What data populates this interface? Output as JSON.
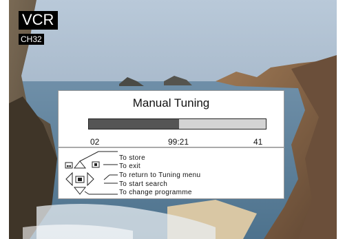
{
  "overlay": {
    "source_label": "VCR",
    "channel_label": "CH32"
  },
  "panel": {
    "title": "Manual Tuning",
    "progress_fraction": 0.51,
    "left_value": "02",
    "center_value": "99:21",
    "right_value": "41",
    "hints": [
      "To store",
      "To exit",
      "To return to Tuning menu",
      "To start search",
      "To change programme"
    ]
  },
  "colors": {
    "progress_fill": "#555555",
    "progress_track": "#d4d4d4",
    "panel_bg": "#ffffff",
    "tag_bg": "#000000"
  },
  "icons": [
    "store-key-icon",
    "exit-key-icon",
    "ok-key-icon",
    "arrow-up-icon",
    "arrow-down-icon",
    "arrow-left-icon",
    "arrow-right-icon"
  ]
}
